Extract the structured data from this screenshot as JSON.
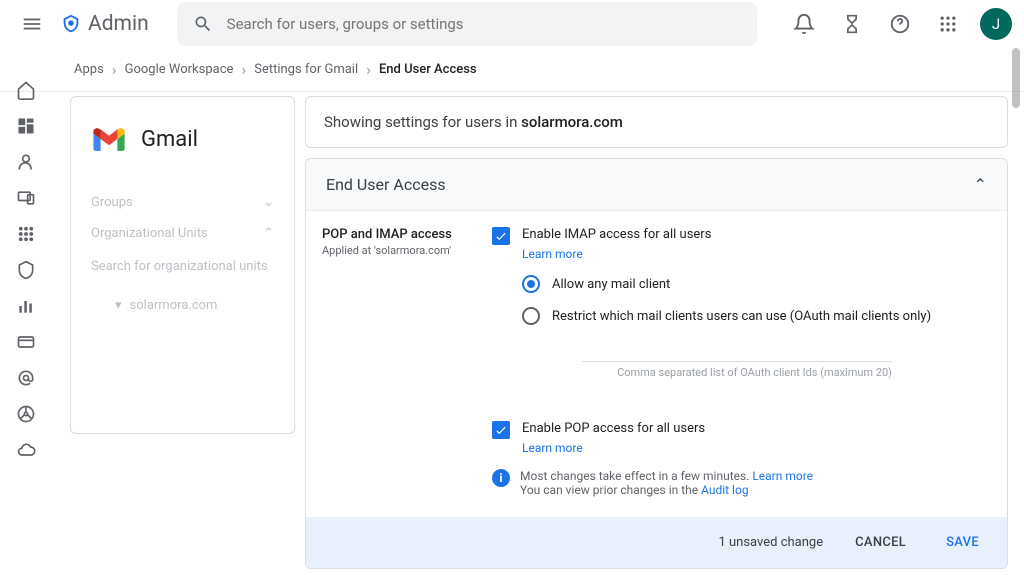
{
  "header": {
    "app": "Admin",
    "search_placeholder": "Search for users, groups or settings",
    "avatar_initial": "J"
  },
  "breadcrumb": [
    "Apps",
    "Google Workspace",
    "Settings for Gmail",
    "End User Access"
  ],
  "left_panel": {
    "title": "Gmail",
    "groups_label": "Groups",
    "ou_label": "Organizational Units",
    "search_placeholder": "Search for organizational units",
    "root_ou": "solarmora.com"
  },
  "banner": {
    "prefix": "Showing settings for users in ",
    "domain": "solarmora.com"
  },
  "section": {
    "title": "End User Access",
    "setting_title": "POP and IMAP access",
    "applied_at": "Applied at 'solarmora.com'",
    "imap_enable": "Enable IMAP access for all users",
    "learn_more": "Learn more",
    "radio_allow": "Allow any mail client",
    "radio_restrict": "Restrict which mail clients users can use (OAuth mail clients only)",
    "oauth_hint": "Comma separated list of OAuth client Ids (maximum 20)",
    "pop_enable": "Enable POP access for all users",
    "info_text1": "Most changes take effect in a few minutes. ",
    "info_text2": "You can view prior changes in the ",
    "audit_log": "Audit log"
  },
  "footer": {
    "unsaved": "1 unsaved change",
    "cancel": "CANCEL",
    "save": "SAVE"
  }
}
